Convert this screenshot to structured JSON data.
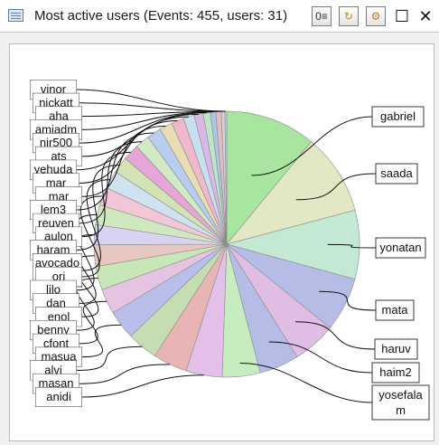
{
  "window": {
    "title": "Most active users  (Events: 455, users: 31)",
    "title_icon": "list-window-icon",
    "buttons": [
      {
        "icon": "view-details-icon",
        "glyph": "0≡"
      },
      {
        "icon": "refresh-icon",
        "glyph": "↻"
      },
      {
        "icon": "settings-gear-icon",
        "glyph": "⚙"
      },
      {
        "icon": "maximize-icon",
        "glyph": "☐"
      },
      {
        "icon": "close-icon",
        "glyph": "✕"
      }
    ]
  },
  "chart_data": {
    "type": "pie",
    "total_events": 455,
    "users": 31,
    "slice_colors": [
      "#a8e6a0",
      "#e2e8c4",
      "#c3e8d3",
      "#b5bde6",
      "#e0bde3",
      "#b5bde6",
      "#c7ecbf",
      "#e3c0ea",
      "#e9b4b4",
      "#c5ddb0",
      "#b9bfea",
      "#e4c4e2",
      "#c8e6b6",
      "#e8c6c2",
      "#d7d3f0",
      "#cfe8c0",
      "#f1c7d7",
      "#cfe2f0",
      "#d3e3b3",
      "#e6a6d8",
      "#d1eac4",
      "#b8cdf0",
      "#e8ddb3",
      "#f0b8cb",
      "#c7e0ef",
      "#d9b8e6",
      "#bde6c8",
      "#a8c8e0",
      "#e6bcc4",
      "#d3d3d3",
      "#c0d8ea"
    ],
    "slices": [
      {
        "label": "gabriel",
        "value": 50
      },
      {
        "label": "saada",
        "value": 45
      },
      {
        "label": "yonatan",
        "value": 38
      },
      {
        "label": "mata",
        "value": 30
      },
      {
        "label": "haruv",
        "value": 24
      },
      {
        "label": "haim2",
        "value": 22
      },
      {
        "label": "yosefalam",
        "value": 21
      },
      {
        "label": "",
        "value": 20
      },
      {
        "label": "",
        "value": 19
      },
      {
        "label": "",
        "value": 17
      },
      {
        "label": "masua",
        "value": 16
      },
      {
        "label": "",
        "value": 14
      },
      {
        "label": "",
        "value": 13
      },
      {
        "label": "",
        "value": 12
      },
      {
        "label": "",
        "value": 11
      },
      {
        "label": "",
        "value": 11
      },
      {
        "label": "",
        "value": 10
      },
      {
        "label": "avocado",
        "value": 10
      },
      {
        "label": "",
        "value": 9
      },
      {
        "label": "",
        "value": 9
      },
      {
        "label": "",
        "value": 8
      },
      {
        "label": "",
        "value": 8
      },
      {
        "label": "",
        "value": 7
      },
      {
        "label": "",
        "value": 7
      },
      {
        "label": "",
        "value": 6
      },
      {
        "label": "",
        "value": 5
      },
      {
        "label": "",
        "value": 4
      },
      {
        "label": "amiadm",
        "value": 3
      },
      {
        "label": "",
        "value": 3
      },
      {
        "label": "",
        "value": 2
      },
      {
        "label": "",
        "value": 1
      }
    ],
    "visible_callouts": [
      {
        "slice": 0,
        "text": "gabriel"
      },
      {
        "slice": 1,
        "text": "saada"
      },
      {
        "slice": 2,
        "text": "yonatan"
      },
      {
        "slice": 3,
        "text": "mata"
      },
      {
        "slice": 4,
        "text": "haruv"
      },
      {
        "slice": 5,
        "text": "haim2"
      },
      {
        "slice": 6,
        "text": "yosefalam"
      },
      {
        "slice": 10,
        "text": "masua"
      },
      {
        "slice": 17,
        "text": "avocado"
      },
      {
        "slice": 27,
        "text": "amiadm"
      }
    ],
    "truncated_callouts": [
      {
        "slice": 7,
        "text": "anidi"
      },
      {
        "slice": 8,
        "text": "masan"
      },
      {
        "slice": 9,
        "text": "alvi"
      },
      {
        "slice": 11,
        "text": "cfont"
      },
      {
        "slice": 12,
        "text": "benny"
      },
      {
        "slice": 13,
        "text": "enol"
      },
      {
        "slice": 14,
        "text": "dan"
      },
      {
        "slice": 15,
        "text": "lilo"
      },
      {
        "slice": 16,
        "text": "ori"
      },
      {
        "slice": 18,
        "text": "haram"
      },
      {
        "slice": 19,
        "text": "aulon"
      },
      {
        "slice": 20,
        "text": "reuven"
      },
      {
        "slice": 21,
        "text": "lem3"
      },
      {
        "slice": 22,
        "text": "mar"
      },
      {
        "slice": 23,
        "text": "mar"
      },
      {
        "slice": 24,
        "text": "yehuda"
      },
      {
        "slice": 25,
        "text": "ats"
      },
      {
        "slice": 26,
        "text": "nir500"
      },
      {
        "slice": 28,
        "text": "aha"
      },
      {
        "slice": 29,
        "text": "nickatt"
      },
      {
        "slice": 30,
        "text": "vinor"
      }
    ]
  }
}
